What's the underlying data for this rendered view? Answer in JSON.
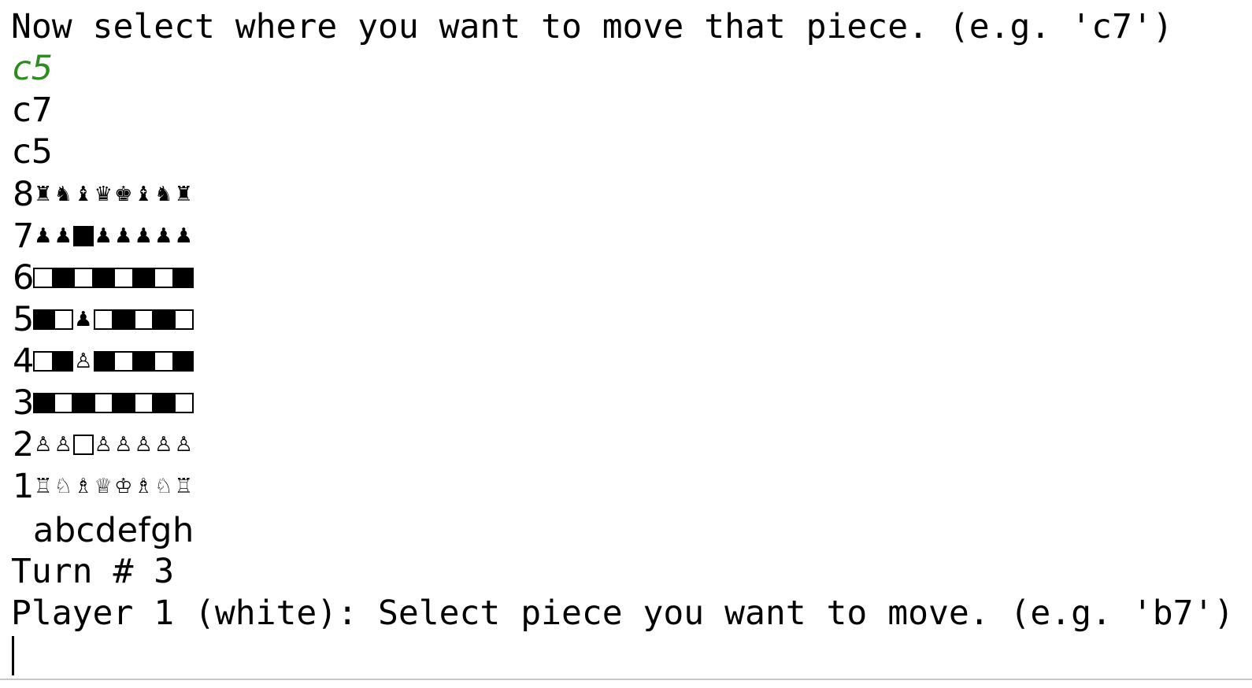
{
  "console": {
    "prompt_move_to": "Now select where you want to move that piece. (e.g. 'c7')",
    "echo_input": "c5",
    "log_from": "c7",
    "log_to": "c5",
    "turn_label": "Turn # 3",
    "prompt_select": "Player 1 (white): Select piece you want to move. (e.g. 'b7')"
  },
  "board": {
    "ranks": [
      {
        "label": "8",
        "squares": [
          "♜",
          "♞",
          "♝",
          "♛",
          "♚",
          "♝",
          "♞",
          "♜"
        ]
      },
      {
        "label": "7",
        "squares": [
          "♟",
          "♟",
          "dark",
          "♟",
          "♟",
          "♟",
          "♟",
          "♟"
        ]
      },
      {
        "label": "6",
        "squares": [
          "light",
          "dark",
          "light",
          "dark",
          "light",
          "dark",
          "light",
          "dark"
        ]
      },
      {
        "label": "5",
        "squares": [
          "dark",
          "light",
          "♟",
          "light",
          "dark",
          "light",
          "dark",
          "light"
        ]
      },
      {
        "label": "4",
        "squares": [
          "light",
          "dark",
          "♙",
          "dark",
          "light",
          "dark",
          "light",
          "dark"
        ]
      },
      {
        "label": "3",
        "squares": [
          "dark",
          "light",
          "dark",
          "light",
          "dark",
          "light",
          "dark",
          "light"
        ]
      },
      {
        "label": "2",
        "squares": [
          "♙",
          "♙",
          "light",
          "♙",
          "♙",
          "♙",
          "♙",
          "♙"
        ]
      },
      {
        "label": "1",
        "squares": [
          "♖",
          "♘",
          "♗",
          "♕",
          "♔",
          "♗",
          "♘",
          "♖"
        ]
      }
    ],
    "files": "abcdefgh"
  },
  "colors": {
    "input_echo": "#2e8b1f",
    "text": "#000000",
    "background": "#ffffff"
  }
}
